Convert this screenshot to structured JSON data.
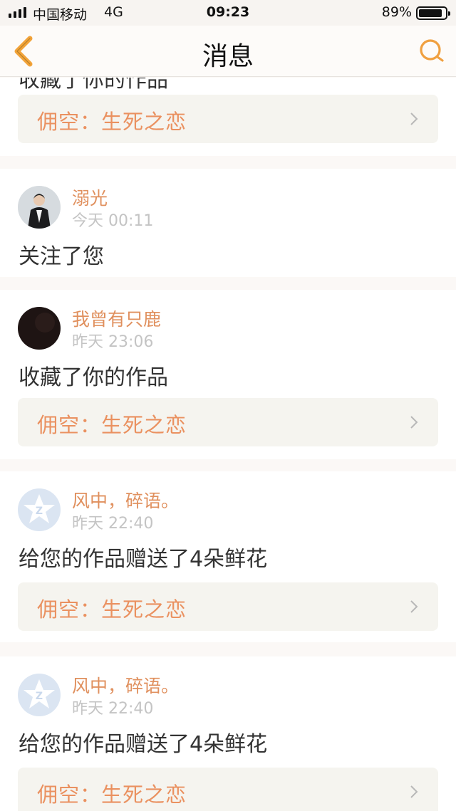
{
  "status_bar": {
    "carrier": "中国移动",
    "network": "4G",
    "time": "09:23",
    "battery_percent_text": "89%",
    "battery_level": 0.89
  },
  "nav": {
    "title": "消息",
    "back_icon": "chevron-left-icon",
    "search_icon": "search-icon"
  },
  "colors": {
    "accent": "#f0a040",
    "name": "#e0905e",
    "work_title": "#ea9160",
    "work_bg": "#f5f4ef"
  },
  "top_partial": {
    "action": "收藏了你的作品",
    "work_title": "佣空：生死之恋"
  },
  "messages": [
    {
      "avatar": "person-photo-avatar",
      "name": "溺光",
      "time": "今天 00:11",
      "action": "关注了您"
    },
    {
      "avatar": "dark-photo-avatar",
      "name": "我曾有只鹿",
      "time": "昨天 23:06",
      "action": "收藏了你的作品",
      "work_title": "佣空：生死之恋"
    },
    {
      "avatar": "default-star-avatar",
      "name": "风中，碎语。",
      "time": "昨天 22:40",
      "action": "给您的作品赠送了4朵鲜花",
      "work_title": "佣空：生死之恋"
    },
    {
      "avatar": "default-star-avatar",
      "name": "风中，碎语。",
      "time": "昨天 22:40",
      "action": "给您的作品赠送了4朵鲜花",
      "work_title": "佣空：生死之恋"
    }
  ]
}
